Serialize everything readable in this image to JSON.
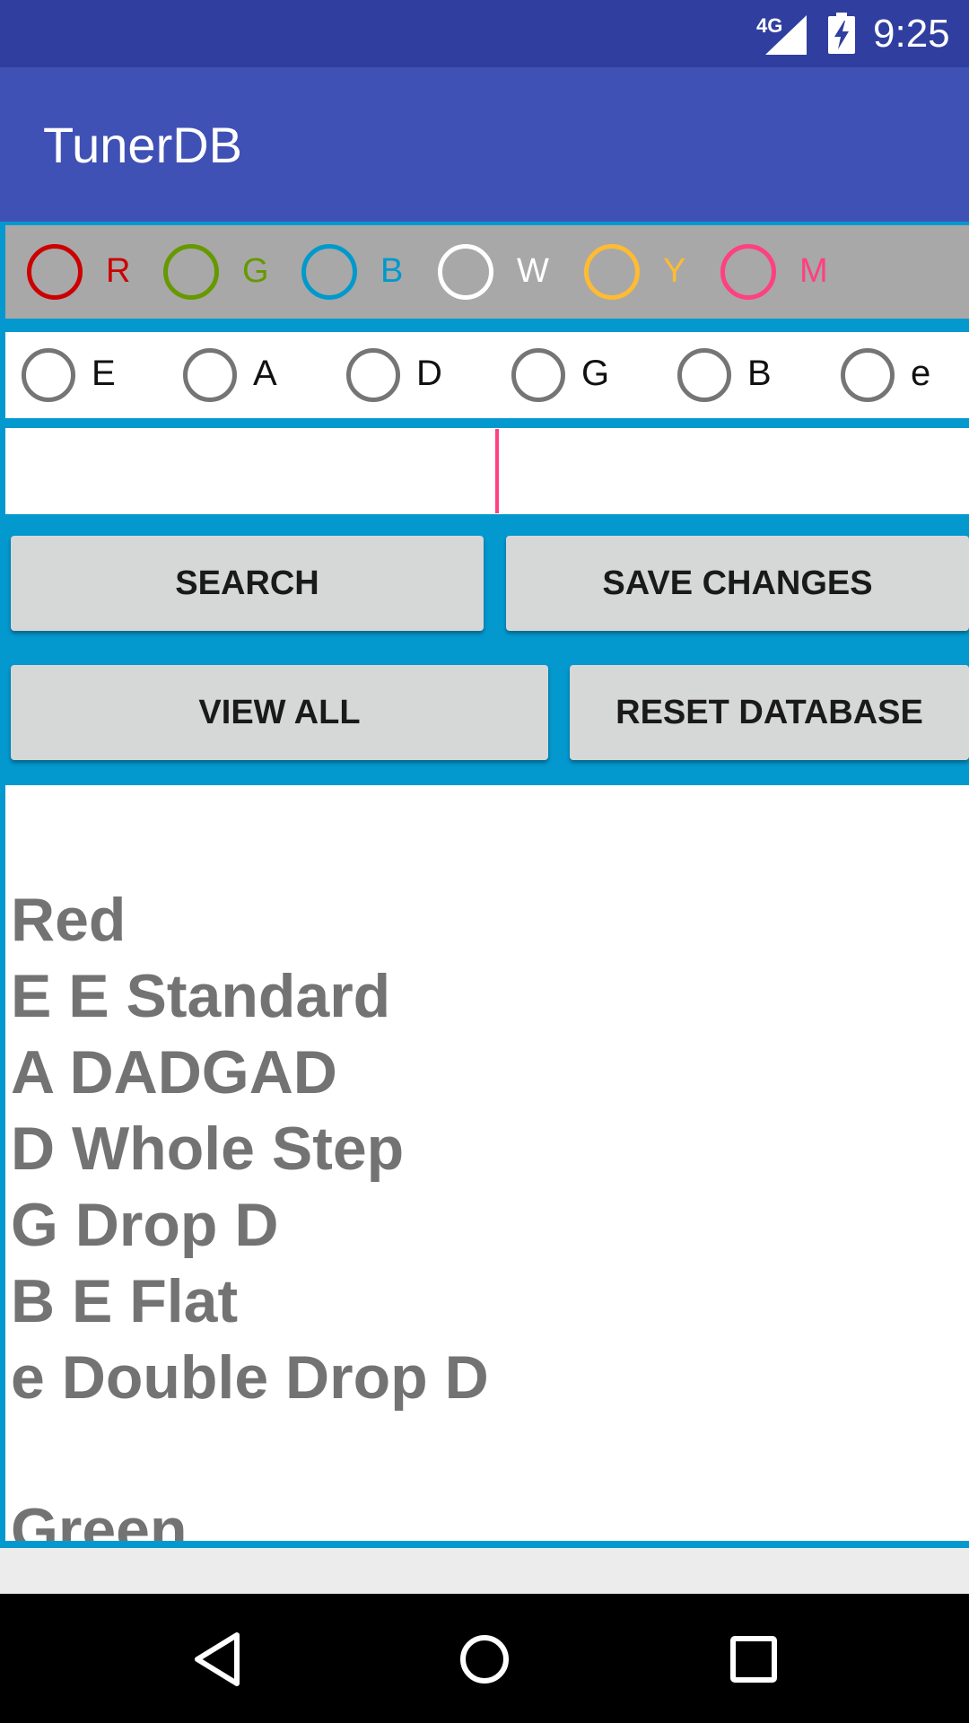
{
  "status_bar": {
    "network": "4G",
    "time": "9:25",
    "icons": [
      "signal-icon",
      "battery-charging-icon"
    ]
  },
  "app_bar": {
    "title": "TunerDB"
  },
  "colors": {
    "status_bar": "#303f9f",
    "app_bar": "#3f51b5",
    "content_background": "#0399cf",
    "color_row_background": "#a8a8a8",
    "cursor": "#ff4081",
    "button": "#d6d7d7",
    "results_text": "#737373"
  },
  "color_options": [
    {
      "label": "R",
      "color": "#cc0000"
    },
    {
      "label": "G",
      "color": "#669900"
    },
    {
      "label": "B",
      "color": "#0099cc"
    },
    {
      "label": "W",
      "color": "#ffffff"
    },
    {
      "label": "Y",
      "color": "#ffbb33"
    },
    {
      "label": "M",
      "color": "#ff4081"
    }
  ],
  "string_options": [
    {
      "label": "E"
    },
    {
      "label": "A"
    },
    {
      "label": "D"
    },
    {
      "label": "G"
    },
    {
      "label": "B"
    },
    {
      "label": "e"
    }
  ],
  "input": {
    "value": ""
  },
  "buttons": {
    "search": "SEARCH",
    "save_changes": "SAVE CHANGES",
    "view_all": "VIEW ALL",
    "reset_database": "RESET DATABASE"
  },
  "results": {
    "text": "Red\nE E Standard\nA DADGAD\nD Whole Step\nG Drop D\nB E Flat\ne Double Drop D\n\nGreen"
  },
  "nav_bar": {
    "icons": [
      "back-icon",
      "home-icon",
      "recents-icon"
    ]
  }
}
